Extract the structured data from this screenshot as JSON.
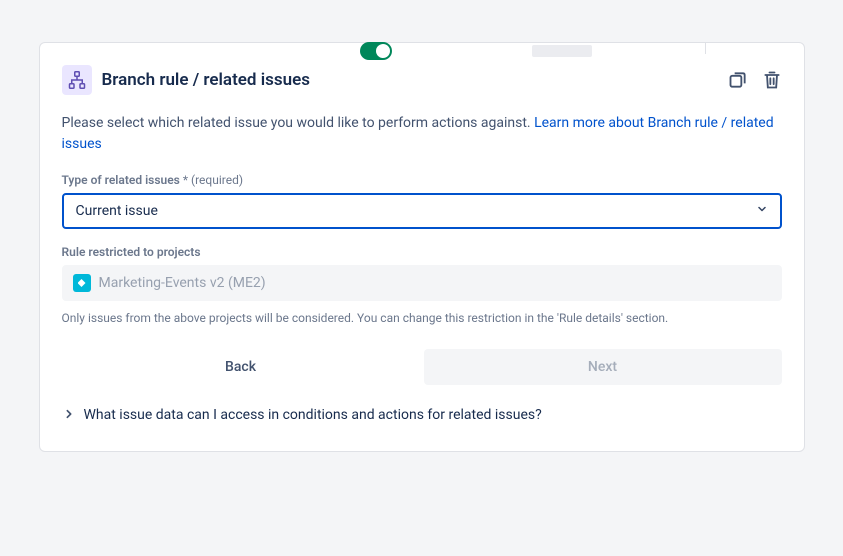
{
  "header": {
    "title": "Branch rule / related issues"
  },
  "desc": {
    "text": "Please select which related issue you would like to perform actions against. ",
    "link": "Learn more about Branch rule / related issues"
  },
  "field": {
    "label": "Type of related issues",
    "required_suffix": "* (required)",
    "selected": "Current issue"
  },
  "projects": {
    "label": "Rule restricted to projects",
    "name": "Marketing-Events v2 (ME2)"
  },
  "helper": {
    "text": "Only issues from the above projects will be considered. You can change this restriction in the 'Rule details' section."
  },
  "buttons": {
    "back": "Back",
    "next": "Next"
  },
  "expando": {
    "label": "What issue data can I access in conditions and actions for related issues?"
  }
}
